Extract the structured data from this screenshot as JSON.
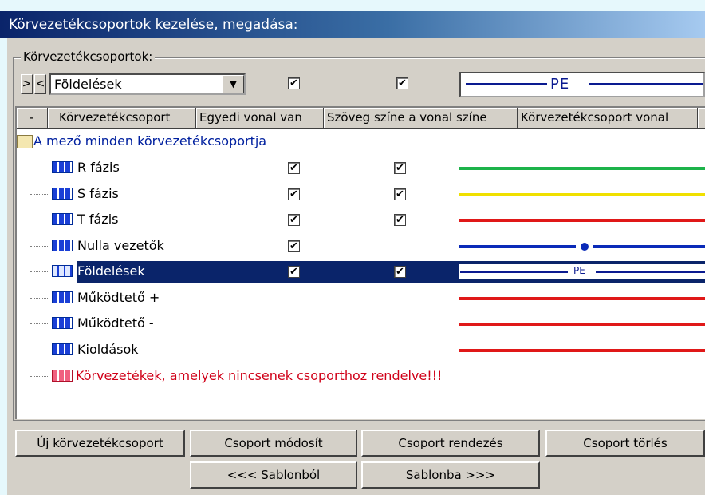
{
  "title": "Körvezetékcsoportok kezelése, megadása:",
  "group_label": "Körvezetékcsoportok:",
  "nav": {
    "next": ">",
    "prev": "<"
  },
  "top": {
    "combo_value": "Földelések",
    "combo_arrow": "▼",
    "individual_line_checked": true,
    "text_color_checked": true,
    "preview_text": "PE"
  },
  "columns": [
    "-",
    "Körvezetékcsoport",
    "Egyedi vonal van",
    "Szöveg színe a vonal színe",
    "Körvezetékcsoport vonal"
  ],
  "root_label": "A mező minden körvezetékcsoportja",
  "rows": [
    {
      "label": "R fázis",
      "individual": true,
      "textcolor": true,
      "line_color": "#1db34a",
      "style": "solid"
    },
    {
      "label": "S fázis",
      "individual": true,
      "textcolor": true,
      "line_color": "#f0e000",
      "style": "solid"
    },
    {
      "label": "T fázis",
      "individual": true,
      "textcolor": true,
      "line_color": "#e01818",
      "style": "solid"
    },
    {
      "label": "Nulla vezetők",
      "individual": true,
      "textcolor": false,
      "line_color": "#0a2ab8",
      "style": "dot"
    },
    {
      "label": "Földelések",
      "individual": true,
      "textcolor": true,
      "line_color": "#0a1a90",
      "style": "pe",
      "line_text": "PE"
    },
    {
      "label": "Működtető +",
      "individual": false,
      "textcolor": false,
      "line_color": "#e01818",
      "style": "solid"
    },
    {
      "label": "Működtető -",
      "individual": false,
      "textcolor": false,
      "line_color": "#e01818",
      "style": "solid"
    },
    {
      "label": "Kioldások",
      "individual": false,
      "textcolor": false,
      "line_color": "#e01818",
      "style": "solid"
    }
  ],
  "unassigned_label": "Körvezetékek, amelyek nincsenek csoporthoz rendelve!!!",
  "check_mark": "✔",
  "buttons": {
    "new": "Új körvezetékcsoport",
    "modify": "Csoport módosít",
    "sort": "Csoport rendezés",
    "delete": "Csoport törlés",
    "from_template": "<<< Sablonból",
    "to_template": "Sablonba >>>"
  },
  "colors": {
    "selection": "#0a246a",
    "root_text": "#00209f",
    "unassigned_text": "#d00018"
  }
}
